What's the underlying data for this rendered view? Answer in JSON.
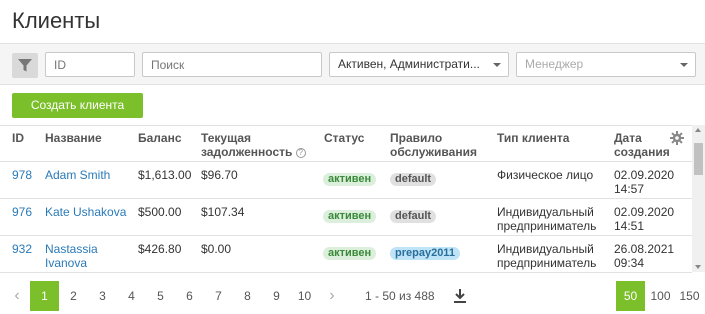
{
  "page": {
    "title": "Клиенты"
  },
  "filters": {
    "id_placeholder": "ID",
    "search_placeholder": "Поиск",
    "status_value": "Активен, Администрати...",
    "manager_placeholder": "Менеджер"
  },
  "actions": {
    "create_label": "Создать клиента"
  },
  "table": {
    "headers": {
      "id": "ID",
      "name": "Название",
      "balance": "Баланс",
      "debt_line1": "Текущая",
      "debt_line2": "задолженность",
      "status": "Статус",
      "rule_line1": "Правило",
      "rule_line2": "обслуживания",
      "type": "Тип клиента",
      "created_line1": "Дата",
      "created_line2": "создания"
    },
    "rows": [
      {
        "id": "978",
        "name_line1": "Adam Smith",
        "name_line2": "",
        "balance": "$1,613.00",
        "debt": "$96.70",
        "status": "активен",
        "rule": "default",
        "type_line1": "Физическое лицо",
        "type_line2": "",
        "created_date": "02.09.2020",
        "created_time": "14:57"
      },
      {
        "id": "976",
        "name_line1": "Kate Ushakova",
        "name_line2": "",
        "balance": "$500.00",
        "debt": "$107.34",
        "status": "активен",
        "rule": "default",
        "type_line1": "Индивидуальный",
        "type_line2": "предприниматель",
        "created_date": "02.09.2020",
        "created_time": "14:51"
      },
      {
        "id": "932",
        "name_line1": "Nastassia",
        "name_line2": "Ivanova",
        "balance": "$426.80",
        "debt": "$0.00",
        "status": "активен",
        "rule": "prepay2011",
        "type_line1": "Индивидуальный",
        "type_line2": "предприниматель",
        "created_date": "26.08.2021",
        "created_time": "09:34"
      }
    ]
  },
  "pagination": {
    "pages": [
      "1",
      "2",
      "3",
      "4",
      "5",
      "6",
      "7",
      "8",
      "9",
      "10"
    ],
    "current_page": "1",
    "range": "1 - 50 из 488",
    "per_page": [
      "50",
      "100",
      "150"
    ],
    "per_page_selected": "50"
  },
  "colors": {
    "accent": "#7bbf2a",
    "link": "#2a7ab8",
    "status_bg": "#dcefdc",
    "prepay_bg": "#bfe3f7"
  }
}
